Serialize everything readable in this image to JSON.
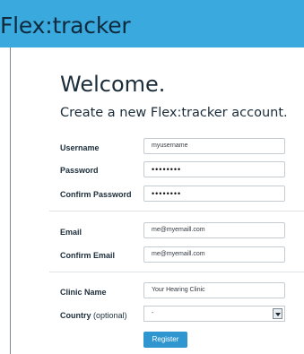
{
  "header": {
    "logo_text": "Flex:tracker",
    "background_color": "#3aa9de"
  },
  "page": {
    "title": "Welcome.",
    "subtitle": "Create a new Flex:tracker account."
  },
  "form": {
    "username": {
      "label": "Username",
      "value": "myusername"
    },
    "password": {
      "label": "Password",
      "value": "••••••••"
    },
    "confirm_password": {
      "label": "Confirm Password",
      "value": "••••••••"
    },
    "email": {
      "label": "Email",
      "value": "me@myemaill.com"
    },
    "confirm_email": {
      "label": "Confirm Email",
      "value": "me@myemaill.com"
    },
    "clinic_name": {
      "label": "Clinic Name",
      "value": "Your Hearing Clinic"
    },
    "country": {
      "label": "Country",
      "optional": "(optional)",
      "selected": "-"
    },
    "submit_label": "Register",
    "button_color": "#2f96d0"
  }
}
